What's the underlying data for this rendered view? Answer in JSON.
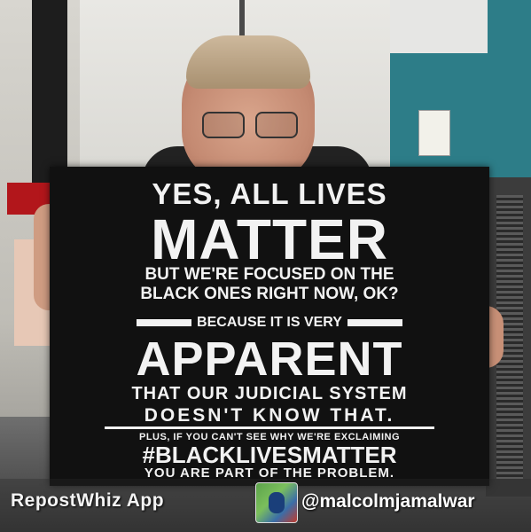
{
  "sign": {
    "line1": "YES, ALL LIVES",
    "line2": "MATTER",
    "line3": "BUT WE'RE FOCUSED ON THE",
    "line4": "BLACK ONES RIGHT NOW, OK?",
    "line5": "BECAUSE IT IS VERY",
    "line6": "APPARENT",
    "line7": "THAT OUR JUDICIAL SYSTEM",
    "line8": "DOESN'T KNOW THAT.",
    "line9": "PLUS, IF YOU CAN'T SEE WHY WE'RE EXCLAIMING",
    "line10": "#BLACKLIVESMATTER",
    "line11": "YOU ARE PART OF THE PROBLEM."
  },
  "watermark": {
    "app": "RepostWhiz App",
    "handle": "@malcolmjamalwar"
  },
  "colors": {
    "sign_background": "#111111",
    "sign_text": "#f2f2f2",
    "teal_wall": "#2d7d88"
  },
  "icons": {
    "avatar": "profile-avatar-icon"
  }
}
